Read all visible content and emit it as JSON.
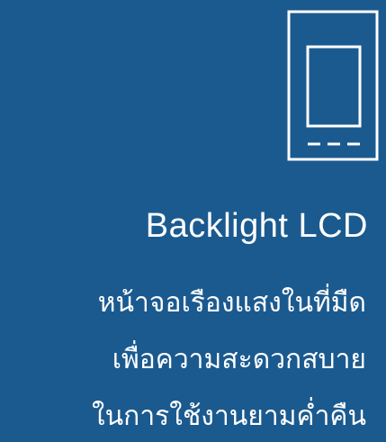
{
  "icon": {
    "name": "lcd-display-icon"
  },
  "feature": {
    "title": "Backlight LCD",
    "description": [
      "หน้าจอเรืองแสงในที่มืด",
      "เพื่อความสะดวกสบาย",
      "ในการใช้งานยามค่ำคืน"
    ]
  },
  "colors": {
    "background": "#1b5a8f",
    "foreground": "#ffffff"
  }
}
